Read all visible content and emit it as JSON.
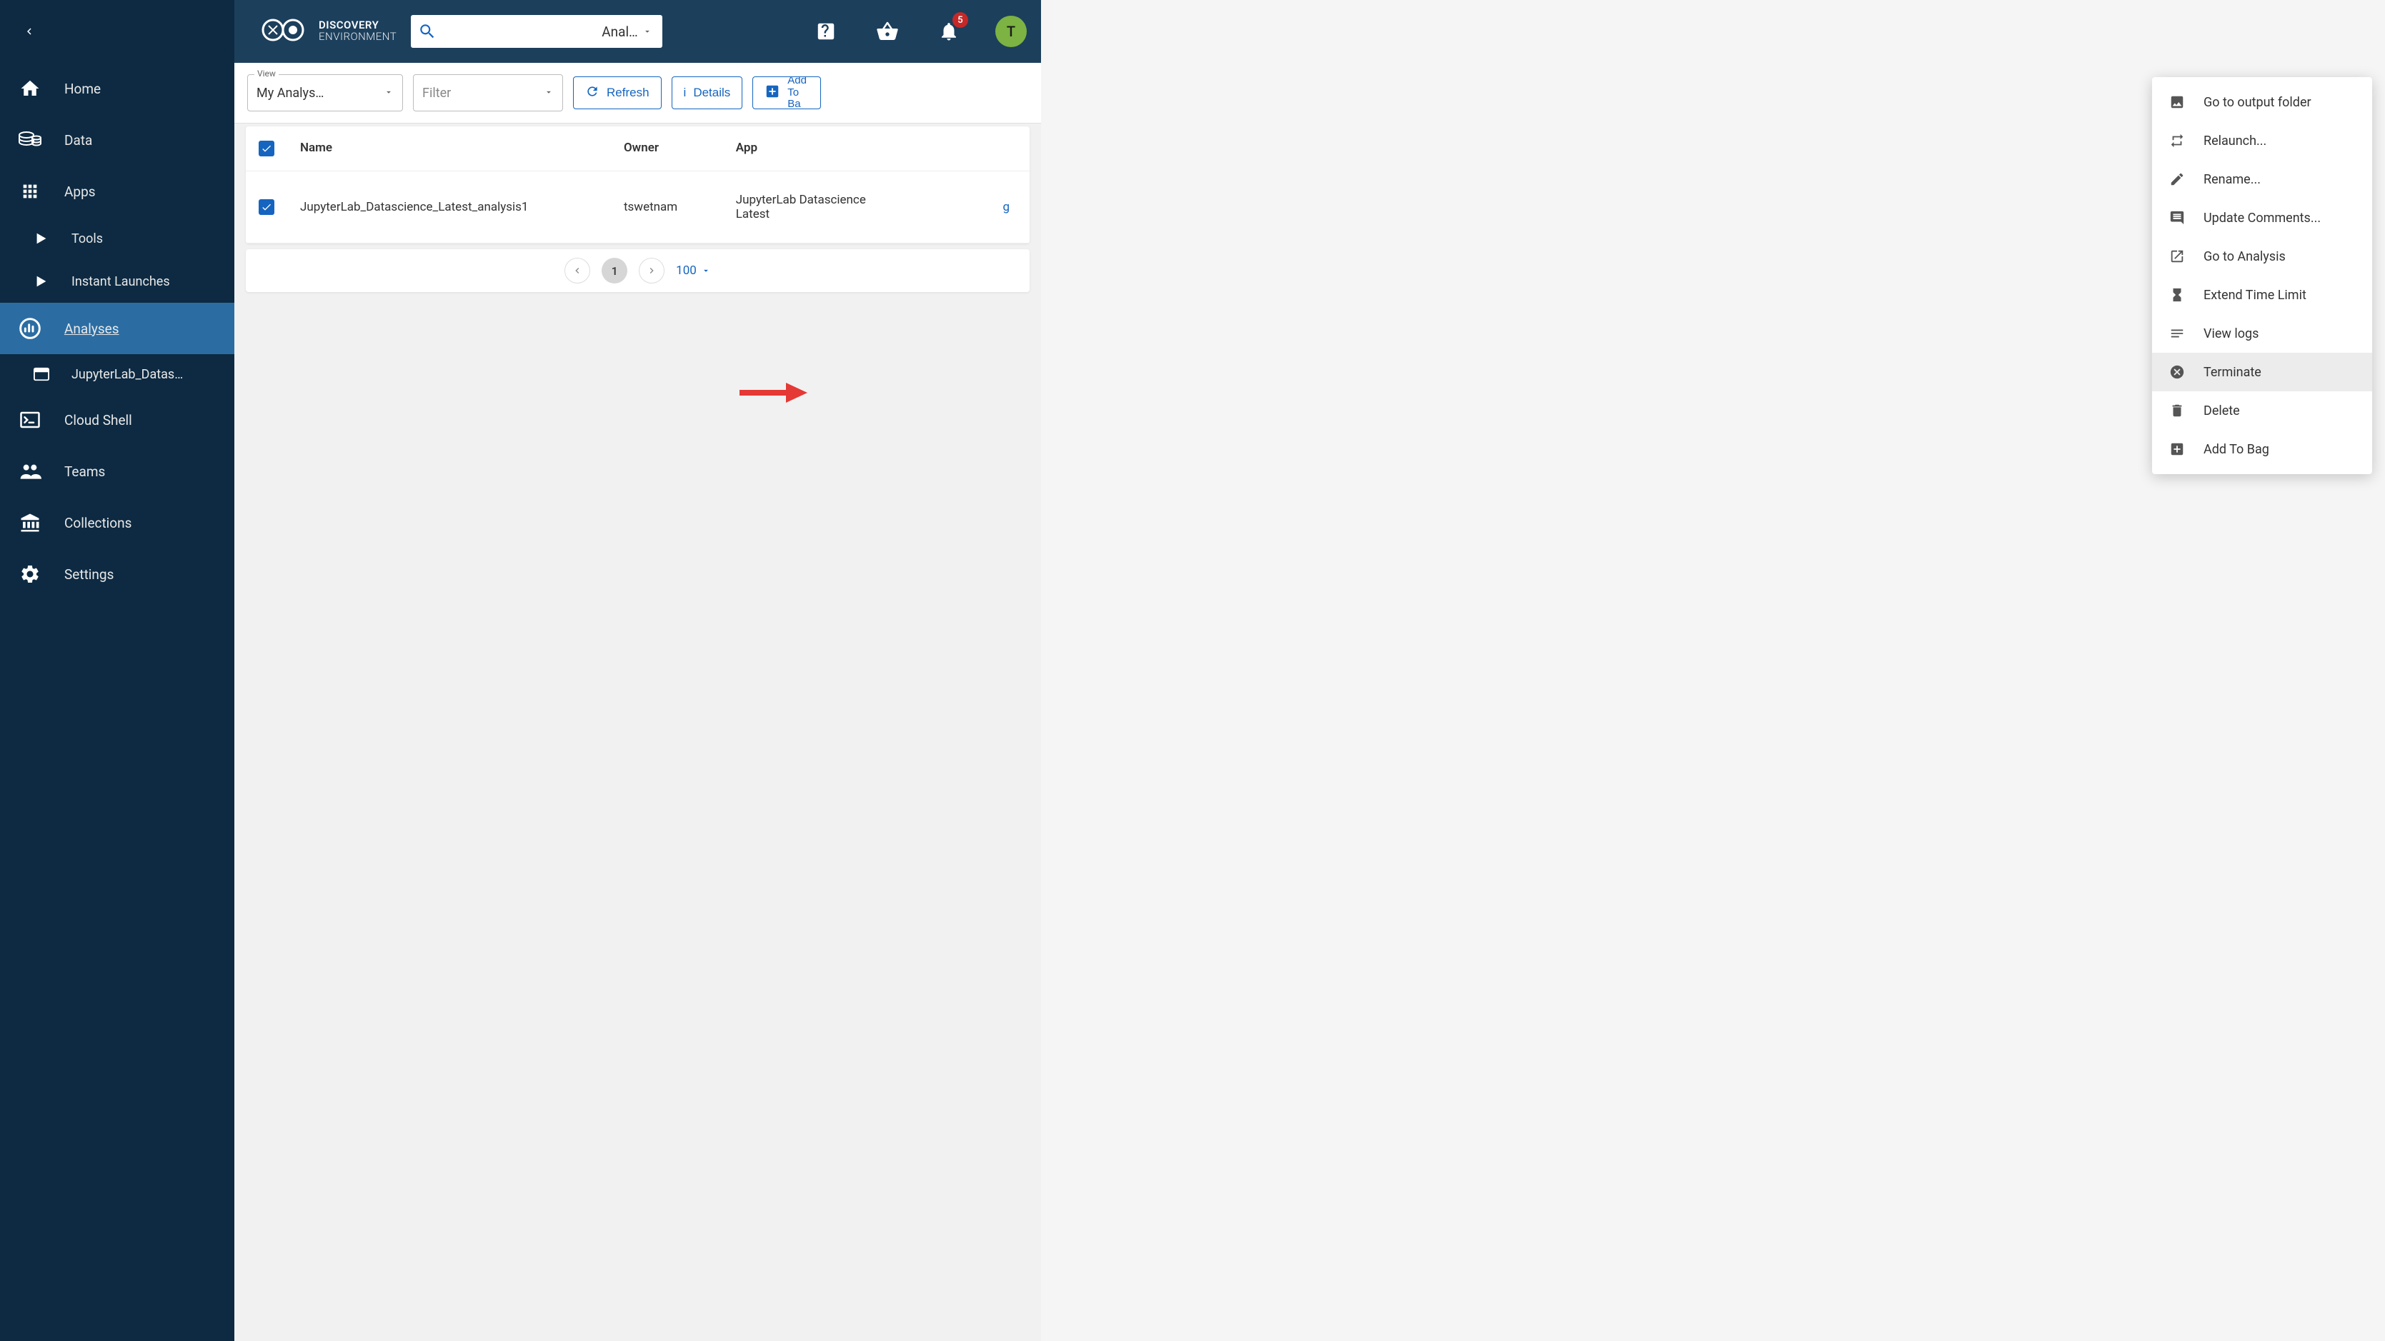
{
  "brand": {
    "line1": "DISCOVERY",
    "line2": "ENVIRONMENT"
  },
  "search": {
    "placeholder": "",
    "type_label": "Anal…"
  },
  "notifications": {
    "count": "5"
  },
  "avatar": {
    "initial": "T"
  },
  "sidebar": {
    "home": "Home",
    "data": "Data",
    "apps": "Apps",
    "tools": "Tools",
    "instant_launches": "Instant Launches",
    "analyses": "Analyses",
    "analysis_item": "JupyterLab_Datas…",
    "cloud_shell": "Cloud Shell",
    "teams": "Teams",
    "collections": "Collections",
    "settings": "Settings"
  },
  "toolbar": {
    "view_label": "View",
    "view_value": "My Analys…",
    "filter_placeholder": "Filter",
    "refresh": "Refresh",
    "details": "Details",
    "add_to_bag_line1": "Add To",
    "add_to_bag_line2": "Ba"
  },
  "table": {
    "headers": {
      "name": "Name",
      "owner": "Owner",
      "app": "App",
      "start": ""
    },
    "rows": [
      {
        "name": "JupyterLab_Datascience_Latest_analysis1",
        "owner": "tswetnam",
        "app": "JupyterLab Datascience Latest",
        "start": "g"
      }
    ]
  },
  "paginator": {
    "page": "1",
    "page_size": "100"
  },
  "context_menu": {
    "output_folder": "Go to output folder",
    "relaunch": "Relaunch...",
    "rename": "Rename...",
    "update_comments": "Update Comments...",
    "go_to_analysis": "Go to Analysis",
    "extend_time": "Extend Time Limit",
    "view_logs": "View logs",
    "terminate": "Terminate",
    "delete": "Delete",
    "add_to_bag": "Add To Bag"
  }
}
